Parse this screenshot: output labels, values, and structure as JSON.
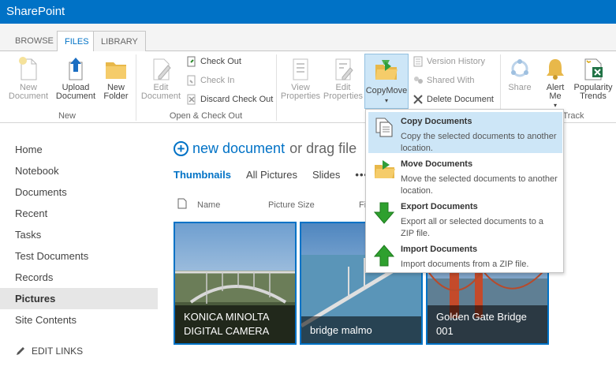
{
  "suite": {
    "title": "SharePoint"
  },
  "tabs": [
    {
      "label": "BROWSE"
    },
    {
      "label": "FILES"
    },
    {
      "label": "LIBRARY"
    }
  ],
  "ribbon": {
    "new_document": "New\nDocument",
    "new_document_l1": "New",
    "new_document_l2": "Document",
    "upload_l1": "Upload",
    "upload_l2": "Document",
    "new_folder_l1": "New",
    "new_folder_l2": "Folder",
    "group_new": "New",
    "edit_doc_l1": "Edit",
    "edit_doc_l2": "Document",
    "check_out": "Check Out",
    "check_in": "Check In",
    "discard_check_out": "Discard Check Out",
    "group_open": "Open & Check Out",
    "view_props_l1": "View",
    "view_props_l2": "Properties",
    "edit_props_l1": "Edit",
    "edit_props_l2": "Properties",
    "copymove": "CopyMove",
    "version_history": "Version History",
    "shared_with": "Shared With",
    "delete_document": "Delete Document",
    "share": "Share",
    "alert_l1": "Alert",
    "alert_l2": "Me",
    "popularity_l1": "Popularity",
    "popularity_l2": "Trends",
    "group_track": "Track"
  },
  "menu": {
    "items": [
      {
        "title": "Copy Documents",
        "desc": "Copy the selected documents to another location."
      },
      {
        "title": "Move Documents",
        "desc": "Move the selected documents to another location."
      },
      {
        "title": "Export Documents",
        "desc": "Export all or selected documents to a ZIP file."
      },
      {
        "title": "Import Documents",
        "desc": "Import documents from a ZIP file."
      }
    ]
  },
  "nav": {
    "items": [
      {
        "label": "Home"
      },
      {
        "label": "Notebook"
      },
      {
        "label": "Documents"
      },
      {
        "label": "Recent"
      },
      {
        "label": "Tasks"
      },
      {
        "label": "Test Documents"
      },
      {
        "label": "Records"
      },
      {
        "label": "Pictures"
      },
      {
        "label": "Site Contents"
      }
    ],
    "edit_links": "EDIT LINKS"
  },
  "main": {
    "new_document": "new document",
    "drag_text": "or drag file",
    "views": [
      "Thumbnails",
      "All Pictures",
      "Slides"
    ],
    "more": "•••",
    "columns": {
      "name": "Name",
      "picture_size": "Picture Size",
      "f": "Fi"
    },
    "tiles": [
      {
        "caption": "KONICA MINOLTA DIGITAL CAMERA"
      },
      {
        "caption": "bridge malmo"
      },
      {
        "caption": "Golden Gate Bridge 001"
      }
    ]
  },
  "colors": {
    "brand": "#0072c6",
    "hover": "#cde6f7"
  }
}
